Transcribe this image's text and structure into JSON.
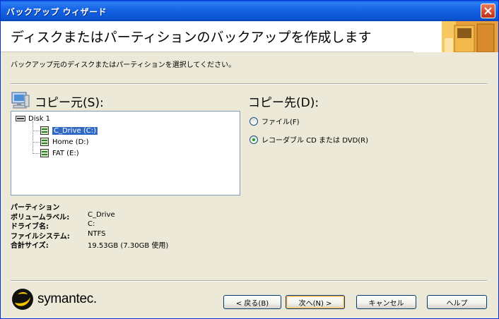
{
  "window": {
    "title": "バックアップ ウィザード"
  },
  "header": {
    "title": "ディスクまたはパーティションのバックアップを作成します"
  },
  "subtitle": "バックアップ元のディスクまたはパーティションを選択してください。",
  "source": {
    "label": "コピー元(S):",
    "tree": [
      {
        "label": "Disk 1",
        "level": 0
      },
      {
        "label": "C_Drive (C:)",
        "level": 1,
        "selected": true
      },
      {
        "label": "Home (D:)",
        "level": 1
      },
      {
        "label": "FAT (E:)",
        "level": 1
      }
    ]
  },
  "partition_info": {
    "heading": "パーティション",
    "rows": [
      {
        "key": "ボリュームラベル:",
        "value": "C_Drive"
      },
      {
        "key": "ドライブ名:",
        "value": "C:"
      },
      {
        "key": "ファイルシステム:",
        "value": "NTFS"
      },
      {
        "key": "合計サイズ:",
        "value": "19.53GB (7.30GB 使用)"
      }
    ]
  },
  "destination": {
    "label": "コピー先(D):",
    "options": [
      {
        "label": "ファイル(F)",
        "checked": false
      },
      {
        "label": "レコーダブル CD または DVD(R)",
        "checked": true
      }
    ]
  },
  "branding": {
    "logo_text": "symantec."
  },
  "buttons": {
    "back": "< 戻る(B)",
    "next": "次へ(N) >",
    "cancel": "キャンセル",
    "help": "ヘルプ"
  },
  "colors": {
    "titlebar": "#0A54D1",
    "selection": "#316AC5",
    "dialog_bg": "#ECE9D8"
  }
}
